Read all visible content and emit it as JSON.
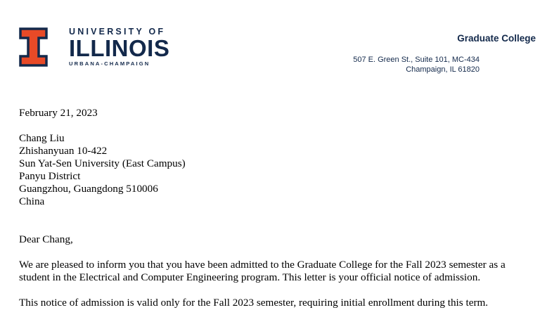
{
  "header": {
    "logo": {
      "line1": "UNIVERSITY OF",
      "line2": "ILLINOIS",
      "line3": "URBANA-CHAMPAIGN",
      "mark_color": "#e84a27",
      "text_color": "#13294b"
    },
    "college": "Graduate College",
    "address": [
      "507 E. Green St., Suite 101, MC-434",
      "Champaign, IL 61820"
    ]
  },
  "letter": {
    "date": "February 21, 2023",
    "recipient": [
      "Chang Liu",
      "Zhishanyuan 10-422",
      "Sun Yat-Sen University (East Campus)",
      "Panyu District",
      "Guangzhou, Guangdong 510006",
      "China"
    ],
    "salutation": "Dear Chang,",
    "paragraphs": [
      "We are pleased to inform you that you have been admitted to the Graduate College for the Fall 2023 semester as a student in the Electrical and Computer Engineering program. This letter is your official notice of admission.",
      "This notice of admission is valid only for the Fall 2023 semester, requiring initial enrollment during this term."
    ]
  }
}
